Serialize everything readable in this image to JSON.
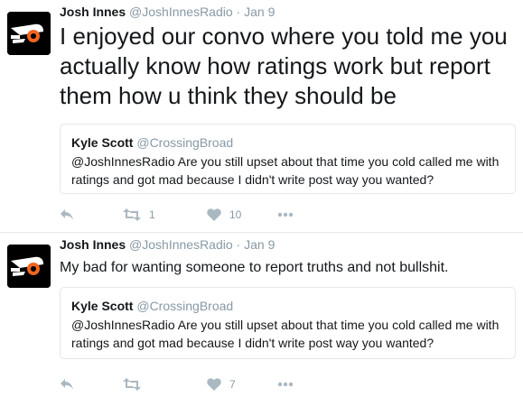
{
  "tweets": [
    {
      "name": "Josh Innes",
      "handle": "@JoshInnesRadio",
      "separator": "·",
      "date": "Jan 9",
      "text": "I enjoyed our convo where you told me you actually know how ratings work but report them how u think they should be",
      "quote": {
        "name": "Kyle Scott",
        "handle": "@CrossingBroad",
        "text": "@JoshInnesRadio Are you still upset about that time you cold called me with ratings and got mad because I didn't write post way you wanted?"
      },
      "retweets": "1",
      "likes": "10"
    },
    {
      "name": "Josh Innes",
      "handle": "@JoshInnesRadio",
      "separator": "·",
      "date": "Jan 9",
      "text": "My bad for wanting someone to report truths and not bullshit.",
      "quote": {
        "name": "Kyle Scott",
        "handle": "@CrossingBroad",
        "text": "@JoshInnesRadio Are you still upset about that time you cold called me with ratings and got mad because I didn't write post way you wanted?"
      },
      "retweets": "",
      "likes": "7"
    }
  ],
  "colors": {
    "text": "#14171a",
    "muted": "#8899a6",
    "icon": "#aab8c2",
    "border": "#e1e8ed",
    "avatar_orange": "#f26522"
  },
  "icons": {
    "avatar": "flyers-logo-avatar",
    "reply": "reply-icon",
    "retweet": "retweet-icon",
    "like": "heart-icon",
    "more": "more-icon"
  }
}
